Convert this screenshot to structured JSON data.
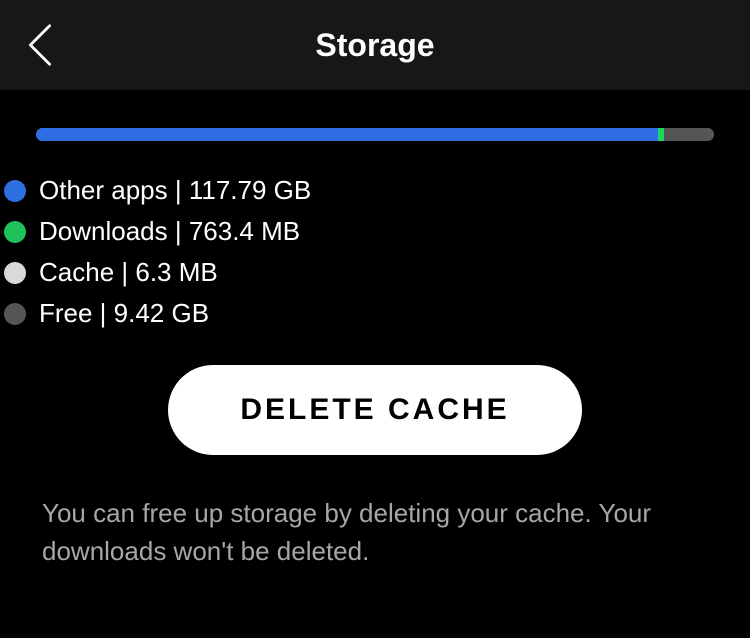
{
  "header": {
    "title": "Storage"
  },
  "storage": {
    "segments": [
      {
        "color": "#2f6ee2",
        "percent": 91.8
      },
      {
        "color": "#1ed760",
        "percent": 0.8
      },
      {
        "color": "#d9d9d9",
        "percent": 0.1
      },
      {
        "color": "#555555",
        "percent": 7.3
      }
    ]
  },
  "legend": {
    "items": [
      {
        "color": "#2f6ee2",
        "text": "Other apps | 117.79 GB"
      },
      {
        "color": "#1ec159",
        "text": "Downloads | 763.4 MB"
      },
      {
        "color": "#d9d9d9",
        "text": "Cache | 6.3 MB"
      },
      {
        "color": "#555555",
        "text": "Free | 9.42 GB"
      }
    ]
  },
  "actions": {
    "delete_cache_label": "DELETE CACHE"
  },
  "help": {
    "text": "You can free up storage by deleting your cache. Your downloads won't be deleted."
  }
}
